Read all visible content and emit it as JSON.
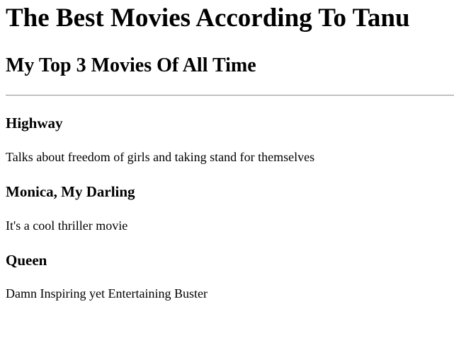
{
  "page": {
    "title": "The Best Movies According To Tanu",
    "section_title": "My Top 3 Movies Of All Time"
  },
  "movies": [
    {
      "title": "Highway",
      "description": "Talks about freedom of girls and taking stand for themselves"
    },
    {
      "title": "Monica, My Darling",
      "description": "It's a cool thriller movie"
    },
    {
      "title": "Queen",
      "description": "Damn Inspiring yet Entertaining Buster"
    }
  ]
}
